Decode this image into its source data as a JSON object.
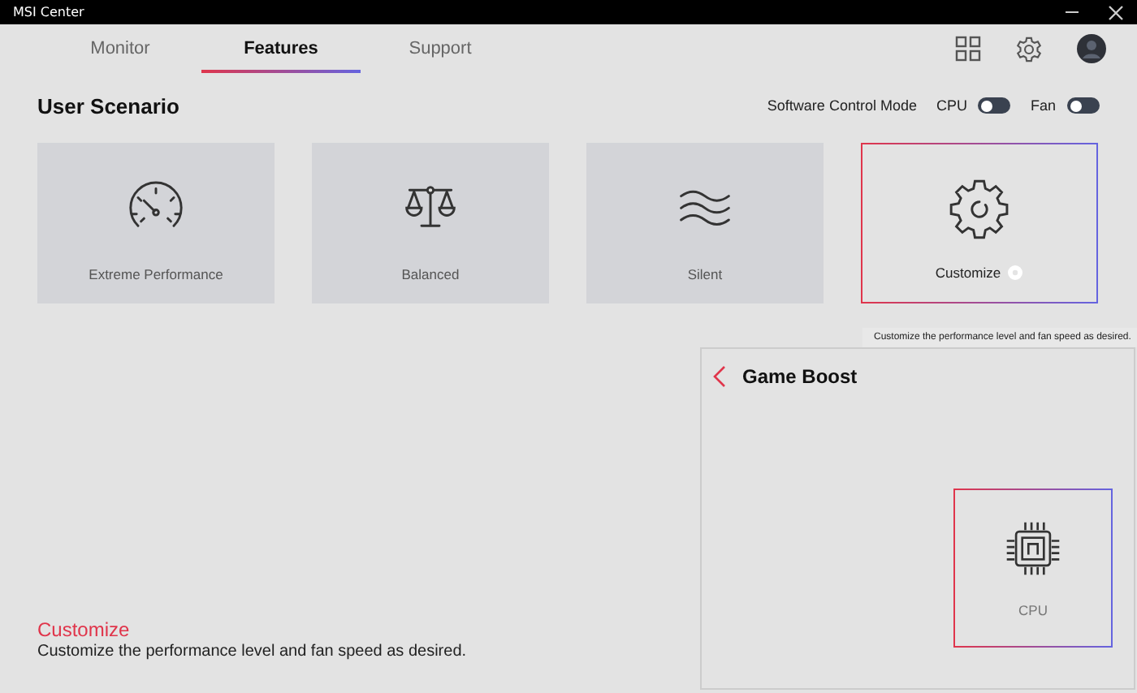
{
  "window": {
    "title": "MSI Center"
  },
  "tabs": [
    {
      "label": "Monitor",
      "selected": false
    },
    {
      "label": "Features",
      "selected": true
    },
    {
      "label": "Support",
      "selected": false
    }
  ],
  "section": {
    "title": "User Scenario",
    "control_mode_label": "Software Control Mode",
    "toggles": [
      {
        "label": "CPU",
        "on": false
      },
      {
        "label": "Fan",
        "on": false
      }
    ]
  },
  "scenarios": [
    {
      "kind": "gauge",
      "label": "Extreme Performance",
      "selected": false
    },
    {
      "kind": "scale",
      "label": "Balanced",
      "selected": false
    },
    {
      "kind": "waves",
      "label": "Silent",
      "selected": false
    },
    {
      "kind": "gear",
      "label": "Customize",
      "selected": true
    }
  ],
  "tooltip": "Customize the performance level and fan speed as desired.",
  "description": {
    "title": "Customize",
    "text": "Customize the performance level and fan speed as desired."
  },
  "game_boost": {
    "title": "Game Boost",
    "items": [
      {
        "label": "CPU",
        "selected": true
      }
    ]
  }
}
